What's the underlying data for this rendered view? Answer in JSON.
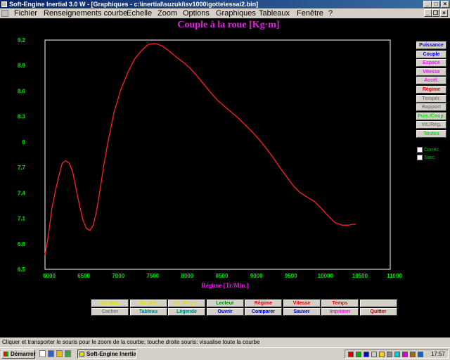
{
  "window": {
    "title": "Soft-Engine Inertial 3.0 W - [Graphiques - c:\\inertial\\suzuki\\sv1000\\gotte\\essai2.bin]",
    "minimize": "_",
    "maximize": "□",
    "close": "×"
  },
  "menu": {
    "items": [
      {
        "label": "Fichier"
      },
      {
        "label": "Renseignements courbe"
      },
      {
        "label": "Echelle"
      },
      {
        "label": "Zoom"
      },
      {
        "label": "Options"
      },
      {
        "label": "Graphiques"
      },
      {
        "label": "Tableaux"
      },
      {
        "label": "Fenêtre"
      },
      {
        "label": "?"
      }
    ],
    "child_minimize": "_",
    "child_restore": "❐",
    "child_close": "×"
  },
  "graph": {
    "title": "Couple à la roue  [Kg·m]"
  },
  "right_buttons": [
    {
      "label": "Puissance",
      "color": "#0000e0"
    },
    {
      "label": "Couple",
      "color": "#0000e0"
    },
    {
      "label": "Espace",
      "color": "#e020e0"
    },
    {
      "label": "Vitesse",
      "color": "#e020e0"
    },
    {
      "label": "Accél.",
      "color": "#e020e0"
    },
    {
      "label": "Régime",
      "color": "#e00000"
    },
    {
      "label": "Tempér.",
      "color": "#808080"
    },
    {
      "label": "Rapport",
      "color": "#808080"
    },
    {
      "label": "Puis./Coup.",
      "color": "#00e000"
    },
    {
      "label": "Vit./Rég.",
      "color": "#808080"
    },
    {
      "label": "Toutes",
      "color": "#00e000"
    }
  ],
  "checkboxes": [
    {
      "label": "Correc."
    },
    {
      "label": "Succ."
    }
  ],
  "bottom_buttons_row1": [
    {
      "label": "Val. Max.",
      "color": "#e0e000"
    },
    {
      "label": "Val. Min.",
      "color": "#e0e000"
    },
    {
      "label": "Val. Moyen.",
      "color": "#e0e000"
    },
    {
      "label": "Lecteur",
      "color": "#008000"
    },
    {
      "label": "Régime",
      "color": "#e00000"
    },
    {
      "label": "Vitesse",
      "color": "#e00000"
    },
    {
      "label": "Temps",
      "color": "#e00000"
    },
    {
      "label": "",
      "color": "#00c0e0"
    }
  ],
  "bottom_buttons_row2": [
    {
      "label": "Cacher",
      "color": "#808080"
    },
    {
      "label": "Tableau",
      "color": "#008080"
    },
    {
      "label": "Légende",
      "color": "#008080"
    },
    {
      "label": "Ouvrir",
      "color": "#0000c0"
    },
    {
      "label": "Comparer",
      "color": "#0000c0"
    },
    {
      "label": "Sauver",
      "color": "#0000c0"
    },
    {
      "label": "Imprimer",
      "color": "#e020e0"
    },
    {
      "label": "Quitter",
      "color": "#c00000"
    }
  ],
  "status": {
    "text": "Cliquer et transporter le souris pour le zoom de la courbe; touche droite souris: visualise toute la courbe"
  },
  "taskbar": {
    "start": "Démarrer",
    "app": "Soft-Engine Inertial...",
    "clock": "17:57"
  },
  "colors": {
    "curve": "#ff2020",
    "axis_ticks": "#00e000",
    "axis_label": "#e020e0",
    "title": "#e020e0"
  },
  "chart_data": {
    "type": "line",
    "title": "Couple à la roue  [Kg·m]",
    "xlabel": "Régime [Tr/Min.]",
    "ylabel": "",
    "xlim": [
      6000,
      11000
    ],
    "ylim": [
      6.5,
      9.2
    ],
    "xticks": [
      "6000",
      "6500",
      "7000",
      "7500",
      "8000",
      "8500",
      "9000",
      "9500",
      "10000",
      "10500",
      "11000"
    ],
    "yticks": [
      "6.5",
      "6.8",
      "7.1",
      "7.4",
      "7.7",
      "8",
      "8.3",
      "8.6",
      "8.9",
      "9.2"
    ],
    "grid": false,
    "series": [
      {
        "x": [
          6000,
          6050,
          6100,
          6150,
          6200,
          6250,
          6300,
          6350,
          6400,
          6450,
          6500,
          6550,
          6600,
          6650,
          6700,
          6750,
          6800,
          6850,
          6900,
          6950,
          7000,
          7100,
          7200,
          7300,
          7400,
          7500,
          7600,
          7700,
          7800,
          7900,
          8000,
          8100,
          8200,
          8300,
          8400,
          8500,
          8600,
          8700,
          8800,
          8900,
          9000,
          9100,
          9200,
          9300,
          9400,
          9500,
          9600,
          9700,
          9800,
          9900,
          10000,
          10100,
          10200,
          10300,
          10400,
          10450,
          10500
        ],
        "y": [
          6.67,
          6.9,
          7.22,
          7.42,
          7.6,
          7.75,
          7.78,
          7.75,
          7.65,
          7.45,
          7.25,
          7.08,
          6.98,
          6.96,
          7.02,
          7.2,
          7.45,
          7.72,
          7.95,
          8.15,
          8.35,
          8.62,
          8.82,
          8.98,
          9.08,
          9.15,
          9.16,
          9.13,
          9.07,
          9.0,
          8.94,
          8.87,
          8.78,
          8.68,
          8.58,
          8.49,
          8.42,
          8.35,
          8.28,
          8.2,
          8.12,
          8.03,
          7.93,
          7.82,
          7.7,
          7.59,
          7.48,
          7.4,
          7.35,
          7.3,
          7.22,
          7.13,
          7.05,
          7.02,
          7.02,
          7.03,
          7.03
        ]
      }
    ]
  }
}
